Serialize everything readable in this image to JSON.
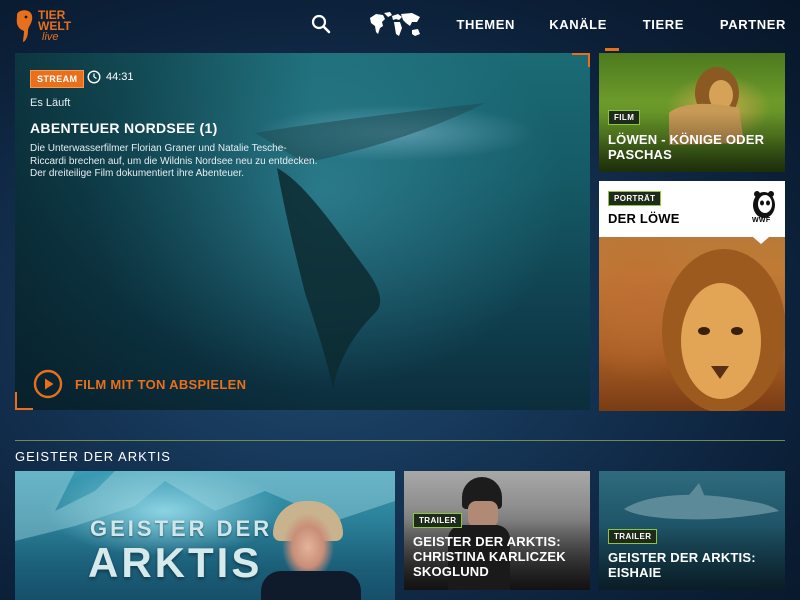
{
  "header": {
    "logo": {
      "line1": "TIER",
      "line2": "WELT",
      "line3": "live"
    },
    "nav": [
      "THEMEN",
      "KANÄLE",
      "TIERE",
      "PARTNER"
    ],
    "icons": {
      "search": "search-icon",
      "map": "world-map-icon"
    },
    "accent": "#e8701c"
  },
  "hero": {
    "badge": "STREAM",
    "duration": "44:31",
    "status": "Es Läuft",
    "title": "ABENTEUER NORDSEE (1)",
    "description": "Die Unterwasserfilmer Florian Graner und Natalie Tesche-Riccardi brechen auf, um die Wildnis Nordsee neu zu entdecken. Der dreiteilige Film dokumentiert ihre Abenteuer.",
    "play_label": "FILM MIT TON ABSPIELEN"
  },
  "side_cards": [
    {
      "tag": "FILM",
      "title": "LÖWEN - KÖNIGE ODER PASCHAS"
    },
    {
      "tag": "PORTRÄT",
      "title": "DER LÖWE",
      "partner": "WWF"
    }
  ],
  "section": {
    "title": "GEISTER DER ARKTIS",
    "main_card": {
      "line1": "GEISTER DER",
      "line2": "ARKTIS"
    },
    "cards": [
      {
        "tag": "TRAILER",
        "title": "GEISTER DER ARKTIS: CHRISTINA KARLICZEK SKOGLUND"
      },
      {
        "tag": "TRAILER",
        "title": "GEISTER DER ARKTIS: EISHAIE"
      }
    ]
  }
}
